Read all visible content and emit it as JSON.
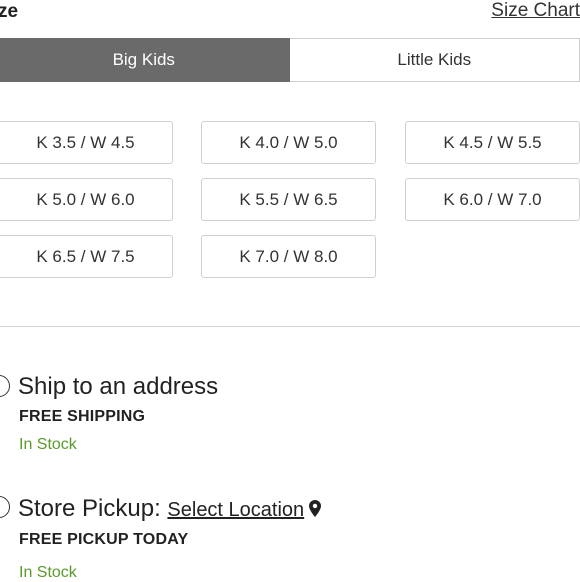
{
  "header": {
    "title": "ze",
    "size_chart_label": "Size Chart"
  },
  "tabs": [
    {
      "label": "Big Kids",
      "active": true
    },
    {
      "label": "Little Kids",
      "active": false
    }
  ],
  "sizes": [
    "K 3.5 / W 4.5",
    "K 4.0 / W 5.0",
    "K 4.5 / W 5.5",
    "K 5.0 / W 6.0",
    "K 5.5 / W 6.5",
    "K 6.0 / W 7.0",
    "K 6.5 / W 7.5",
    "K 7.0 / W 8.0"
  ],
  "fulfillment": {
    "ship": {
      "title": "Ship to an address",
      "subtitle": "FREE SHIPPING",
      "stock": "In Stock"
    },
    "pickup": {
      "title": "Store Pickup:",
      "select_label": "Select Location",
      "subtitle": "FREE PICKUP TODAY",
      "stock": "In Stock"
    }
  },
  "colors": {
    "tab_active_bg": "#6a6a6a",
    "stock_green": "#5a9a2a",
    "border": "#cfcfcf"
  },
  "icons": {
    "location": "map-pin-icon"
  }
}
